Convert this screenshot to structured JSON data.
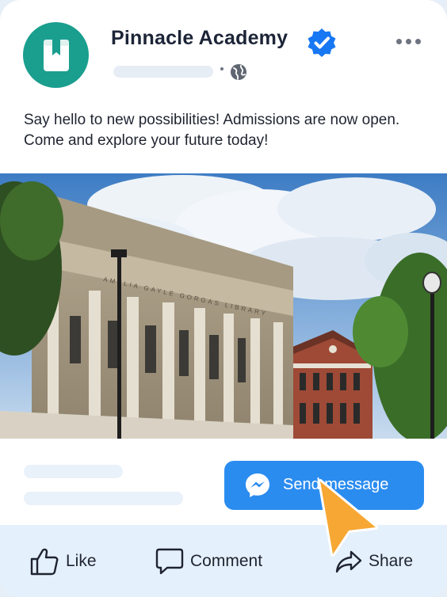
{
  "post": {
    "page_name": "Pinnacle Academy",
    "verified_icon": "verified-badge-icon",
    "privacy_icon": "globe-icon",
    "more_icon": "more-options-icon",
    "text": "Say hello to new possibilities! Admissions are now open. Come and explore your future today!"
  },
  "photo": {
    "building_inscription": "AMELIA GAYLE GORGAS LIBRARY"
  },
  "cta": {
    "label": "Send message",
    "icon": "messenger-icon"
  },
  "actions": [
    {
      "label": "Like",
      "icon": "thumbs-up-icon"
    },
    {
      "label": "Comment",
      "icon": "comment-bubble-icon"
    },
    {
      "label": "Share",
      "icon": "share-arrow-icon"
    }
  ],
  "colors": {
    "avatar": "#1a9e8e",
    "verified": "#1877f2",
    "cta": "#2b8cf0",
    "action_bar": "#e4f0fb",
    "cursor": "#f7a733"
  }
}
